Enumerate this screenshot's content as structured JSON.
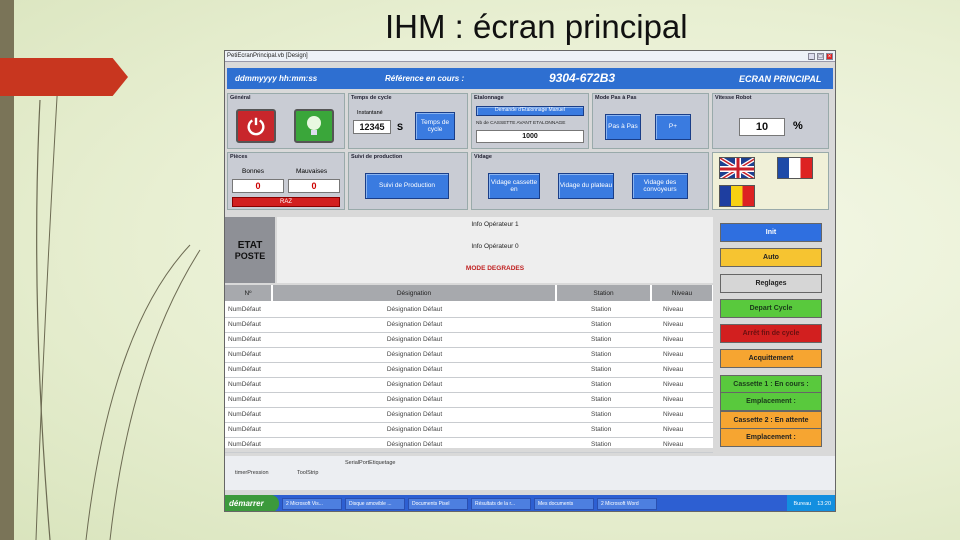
{
  "slide": {
    "title": "IHM : écran principal"
  },
  "window": {
    "title": "PetiEcranPrincipal.vb [Design]"
  },
  "header": {
    "datetime": "ddmmyyyy hh:mm:ss",
    "reference_label": "Référence en cours :",
    "reference_value": "9304-672B3",
    "screen_name": "ECRAN PRINCIPAL"
  },
  "panels": {
    "general": {
      "title": "Général"
    },
    "cycle": {
      "title": "Temps de cycle",
      "sub_label": "Instantané",
      "value": "12345",
      "unit": "S",
      "button": "Temps de cycle"
    },
    "etalonnage": {
      "title": "Etalonnage",
      "button": "Demande d'Etalonnage Manuel",
      "label": "Nb de CASSETTE AVANT ETALONNAGE",
      "value": "1000"
    },
    "mode": {
      "title": "Mode Pas à Pas",
      "btn_step": "Pas à Pas",
      "btn_p": "P+"
    },
    "vitesse": {
      "title": "Vitesse Robot",
      "value": "10",
      "unit": "%"
    },
    "pieces": {
      "title": "Pièces",
      "good_label": "Bonnes",
      "bad_label": "Mauvaises",
      "good_value": "0",
      "bad_value": "0",
      "raz": "RAZ"
    },
    "production": {
      "title": "Suivi de production",
      "button": "Suivi de Production"
    },
    "vidage": {
      "title": "Vidage",
      "btn1": "Vidage cassette en",
      "btn2": "Vidage du plateau",
      "btn3": "Vidage des convoyeurs"
    }
  },
  "status": {
    "etat": "ETAT",
    "poste": "POSTE",
    "info1": "Info Opérateur 1",
    "info0": "Info Opérateur 0",
    "mode": "MODE DEGRADES"
  },
  "grid": {
    "columns": [
      "Nº",
      "Désignation",
      "Station",
      "Niveau"
    ],
    "rows": [
      [
        "NumDéfaut",
        "Désignation Défaut",
        "Station",
        "Niveau"
      ],
      [
        "NumDéfaut",
        "Désignation Défaut",
        "Station",
        "Niveau"
      ],
      [
        "NumDéfaut",
        "Désignation Défaut",
        "Station",
        "Niveau"
      ],
      [
        "NumDéfaut",
        "Désignation Défaut",
        "Station",
        "Niveau"
      ],
      [
        "NumDéfaut",
        "Désignation Défaut",
        "Station",
        "Niveau"
      ],
      [
        "NumDéfaut",
        "Désignation Défaut",
        "Station",
        "Niveau"
      ],
      [
        "NumDéfaut",
        "Désignation Défaut",
        "Station",
        "Niveau"
      ],
      [
        "NumDéfaut",
        "Désignation Défaut",
        "Station",
        "Niveau"
      ],
      [
        "NumDéfaut",
        "Désignation Défaut",
        "Station",
        "Niveau"
      ],
      [
        "NumDéfaut",
        "Désignation Défaut",
        "Station",
        "Niveau"
      ]
    ]
  },
  "right_buttons": [
    {
      "label": "Init",
      "color": "#2f6fe0",
      "text_color": "#ffffff"
    },
    {
      "label": "Auto",
      "color": "#f6c431",
      "text_color": "#222222"
    },
    {
      "label": "Reglages",
      "color": "#d6d6d6",
      "text_color": "#222222"
    },
    {
      "label": "Depart Cycle",
      "color": "#59c93d",
      "text_color": "#1a3a1a"
    },
    {
      "label": "Arrêt fin de cycle",
      "color": "#d21f1f",
      "text_color": "#6b1010"
    },
    {
      "label": "Acquittement",
      "color": "#f6a531",
      "text_color": "#222222"
    },
    {
      "label": "Cassette 1 : En cours :",
      "color": "#59c93d",
      "text_color": "#1a3a1a"
    },
    {
      "label": "Emplacement :",
      "color": "#59c93d",
      "text_color": "#1a3a1a"
    },
    {
      "label": "Cassette 2 : En attente",
      "color": "#f6a531",
      "text_color": "#222222"
    },
    {
      "label": "Emplacement :",
      "color": "#f6a531",
      "text_color": "#222222"
    }
  ],
  "bottom": {
    "item1": "timerPression",
    "item2": "ToolStrip",
    "item3": "SerialPortEtiquetage"
  },
  "taskbar": {
    "start": "démarrer",
    "tasks": [
      "2 Microsoft Vis...",
      "Disque amovible ...",
      "Documents Pisel",
      "Résultats de la r...",
      "Mes documents",
      "2 Microsoft Word"
    ],
    "tray_label": "Bureau",
    "time": "13:20"
  },
  "colors": {
    "accent_blue": "#2e6fd1",
    "panel": "#c9ccd4",
    "alarm_red": "#d21f1f"
  }
}
